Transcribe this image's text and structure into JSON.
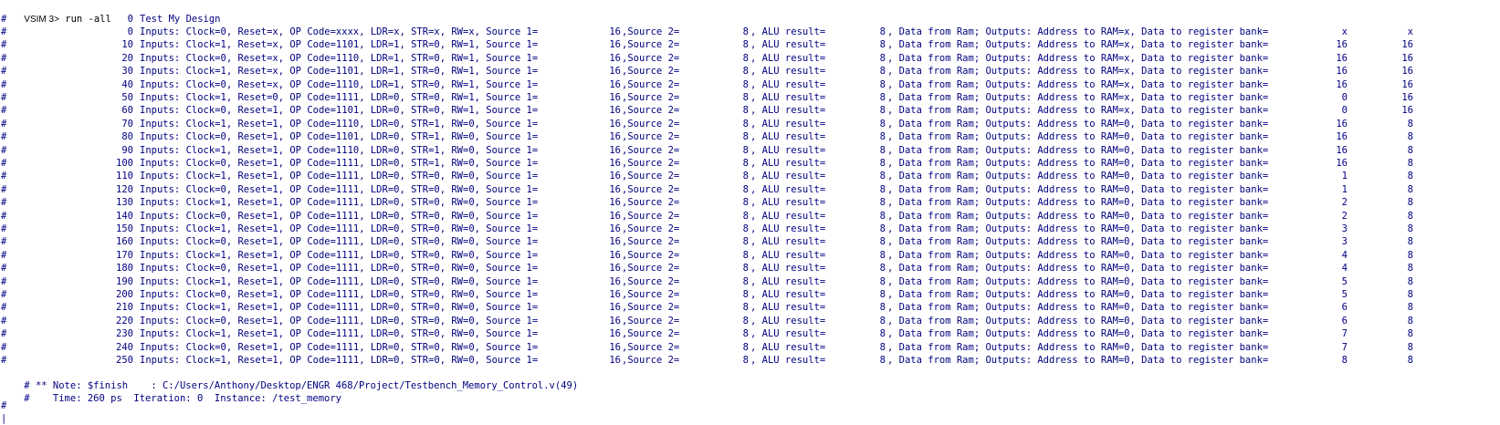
{
  "prompt": {
    "label": "VSIM 3>",
    "command": "run -all"
  },
  "header_line": {
    "hash": "#",
    "time": "0",
    "text": "Test My Design"
  },
  "labels": {
    "inputs": "Inputs:",
    "clock": "Clock=",
    "reset": "Reset=",
    "opcode": "OP Code=",
    "ldr": "LDR=",
    "str": "STR=",
    "rw": "RW=",
    "source1": "Source 1=",
    "source2": "Source 2=",
    "alu": "ALU result=",
    "data_from_ram": "Data from Ram;",
    "outputs": "Outputs:",
    "address_to_ram": "Address to RAM=",
    "data_to_register": "Data to register bank="
  },
  "rows": [
    {
      "time": "0",
      "clock": "0",
      "reset": "x",
      "opcode": "xxxx",
      "ldr": "x",
      "str": "x",
      "rw": "x",
      "src1": "16",
      "src2": "8",
      "alu": "8",
      "addr": "x",
      "reg": "x",
      "last": "x"
    },
    {
      "time": "10",
      "clock": "1",
      "reset": "x",
      "opcode": "1101",
      "ldr": "1",
      "str": "0",
      "rw": "1",
      "src1": "16",
      "src2": "8",
      "alu": "8",
      "addr": "x",
      "reg": "16",
      "last": "16"
    },
    {
      "time": "20",
      "clock": "0",
      "reset": "x",
      "opcode": "1110",
      "ldr": "1",
      "str": "0",
      "rw": "1",
      "src1": "16",
      "src2": "8",
      "alu": "8",
      "addr": "x",
      "reg": "16",
      "last": "16"
    },
    {
      "time": "30",
      "clock": "1",
      "reset": "x",
      "opcode": "1101",
      "ldr": "1",
      "str": "0",
      "rw": "1",
      "src1": "16",
      "src2": "8",
      "alu": "8",
      "addr": "x",
      "reg": "16",
      "last": "16"
    },
    {
      "time": "40",
      "clock": "0",
      "reset": "x",
      "opcode": "1110",
      "ldr": "1",
      "str": "0",
      "rw": "1",
      "src1": "16",
      "src2": "8",
      "alu": "8",
      "addr": "x",
      "reg": "16",
      "last": "16"
    },
    {
      "time": "50",
      "clock": "1",
      "reset": "0",
      "opcode": "1111",
      "ldr": "0",
      "str": "0",
      "rw": "1",
      "src1": "16",
      "src2": "8",
      "alu": "8",
      "addr": "x",
      "reg": "0",
      "last": "16"
    },
    {
      "time": "60",
      "clock": "0",
      "reset": "1",
      "opcode": "1101",
      "ldr": "0",
      "str": "0",
      "rw": "1",
      "src1": "16",
      "src2": "8",
      "alu": "8",
      "addr": "x",
      "reg": "0",
      "last": "16"
    },
    {
      "time": "70",
      "clock": "1",
      "reset": "1",
      "opcode": "1110",
      "ldr": "0",
      "str": "1",
      "rw": "0",
      "src1": "16",
      "src2": "8",
      "alu": "8",
      "addr": "0",
      "reg": "16",
      "last": "8"
    },
    {
      "time": "80",
      "clock": "0",
      "reset": "1",
      "opcode": "1101",
      "ldr": "0",
      "str": "1",
      "rw": "0",
      "src1": "16",
      "src2": "8",
      "alu": "8",
      "addr": "0",
      "reg": "16",
      "last": "8"
    },
    {
      "time": "90",
      "clock": "1",
      "reset": "1",
      "opcode": "1110",
      "ldr": "0",
      "str": "1",
      "rw": "0",
      "src1": "16",
      "src2": "8",
      "alu": "8",
      "addr": "0",
      "reg": "16",
      "last": "8"
    },
    {
      "time": "100",
      "clock": "0",
      "reset": "1",
      "opcode": "1111",
      "ldr": "0",
      "str": "1",
      "rw": "0",
      "src1": "16",
      "src2": "8",
      "alu": "8",
      "addr": "0",
      "reg": "16",
      "last": "8"
    },
    {
      "time": "110",
      "clock": "1",
      "reset": "1",
      "opcode": "1111",
      "ldr": "0",
      "str": "0",
      "rw": "0",
      "src1": "16",
      "src2": "8",
      "alu": "8",
      "addr": "0",
      "reg": "1",
      "last": "8"
    },
    {
      "time": "120",
      "clock": "0",
      "reset": "1",
      "opcode": "1111",
      "ldr": "0",
      "str": "0",
      "rw": "0",
      "src1": "16",
      "src2": "8",
      "alu": "8",
      "addr": "0",
      "reg": "1",
      "last": "8"
    },
    {
      "time": "130",
      "clock": "1",
      "reset": "1",
      "opcode": "1111",
      "ldr": "0",
      "str": "0",
      "rw": "0",
      "src1": "16",
      "src2": "8",
      "alu": "8",
      "addr": "0",
      "reg": "2",
      "last": "8"
    },
    {
      "time": "140",
      "clock": "0",
      "reset": "1",
      "opcode": "1111",
      "ldr": "0",
      "str": "0",
      "rw": "0",
      "src1": "16",
      "src2": "8",
      "alu": "8",
      "addr": "0",
      "reg": "2",
      "last": "8"
    },
    {
      "time": "150",
      "clock": "1",
      "reset": "1",
      "opcode": "1111",
      "ldr": "0",
      "str": "0",
      "rw": "0",
      "src1": "16",
      "src2": "8",
      "alu": "8",
      "addr": "0",
      "reg": "3",
      "last": "8"
    },
    {
      "time": "160",
      "clock": "0",
      "reset": "1",
      "opcode": "1111",
      "ldr": "0",
      "str": "0",
      "rw": "0",
      "src1": "16",
      "src2": "8",
      "alu": "8",
      "addr": "0",
      "reg": "3",
      "last": "8"
    },
    {
      "time": "170",
      "clock": "1",
      "reset": "1",
      "opcode": "1111",
      "ldr": "0",
      "str": "0",
      "rw": "0",
      "src1": "16",
      "src2": "8",
      "alu": "8",
      "addr": "0",
      "reg": "4",
      "last": "8"
    },
    {
      "time": "180",
      "clock": "0",
      "reset": "1",
      "opcode": "1111",
      "ldr": "0",
      "str": "0",
      "rw": "0",
      "src1": "16",
      "src2": "8",
      "alu": "8",
      "addr": "0",
      "reg": "4",
      "last": "8"
    },
    {
      "time": "190",
      "clock": "1",
      "reset": "1",
      "opcode": "1111",
      "ldr": "0",
      "str": "0",
      "rw": "0",
      "src1": "16",
      "src2": "8",
      "alu": "8",
      "addr": "0",
      "reg": "5",
      "last": "8"
    },
    {
      "time": "200",
      "clock": "0",
      "reset": "1",
      "opcode": "1111",
      "ldr": "0",
      "str": "0",
      "rw": "0",
      "src1": "16",
      "src2": "8",
      "alu": "8",
      "addr": "0",
      "reg": "5",
      "last": "8"
    },
    {
      "time": "210",
      "clock": "1",
      "reset": "1",
      "opcode": "1111",
      "ldr": "0",
      "str": "0",
      "rw": "0",
      "src1": "16",
      "src2": "8",
      "alu": "8",
      "addr": "0",
      "reg": "6",
      "last": "8"
    },
    {
      "time": "220",
      "clock": "0",
      "reset": "1",
      "opcode": "1111",
      "ldr": "0",
      "str": "0",
      "rw": "0",
      "src1": "16",
      "src2": "8",
      "alu": "8",
      "addr": "0",
      "reg": "6",
      "last": "8"
    },
    {
      "time": "230",
      "clock": "1",
      "reset": "1",
      "opcode": "1111",
      "ldr": "0",
      "str": "0",
      "rw": "0",
      "src1": "16",
      "src2": "8",
      "alu": "8",
      "addr": "0",
      "reg": "7",
      "last": "8"
    },
    {
      "time": "240",
      "clock": "0",
      "reset": "1",
      "opcode": "1111",
      "ldr": "0",
      "str": "0",
      "rw": "0",
      "src1": "16",
      "src2": "8",
      "alu": "8",
      "addr": "0",
      "reg": "7",
      "last": "8"
    },
    {
      "time": "250",
      "clock": "1",
      "reset": "1",
      "opcode": "1111",
      "ldr": "0",
      "str": "0",
      "rw": "0",
      "src1": "16",
      "src2": "8",
      "alu": "8",
      "addr": "0",
      "reg": "8",
      "last": "8"
    }
  ],
  "note_line": "# ** Note: $finish    : C:/Users/Anthony/Desktop/ENGR 468/Project/Testbench_Memory_Control.v(49)",
  "time_line": "#    Time: 260 ps  Iteration: 0  Instance: /test_memory",
  "caret": "# |",
  "colors": {
    "text": "#000080",
    "prompt": "#000000",
    "background": "#ffffff"
  }
}
